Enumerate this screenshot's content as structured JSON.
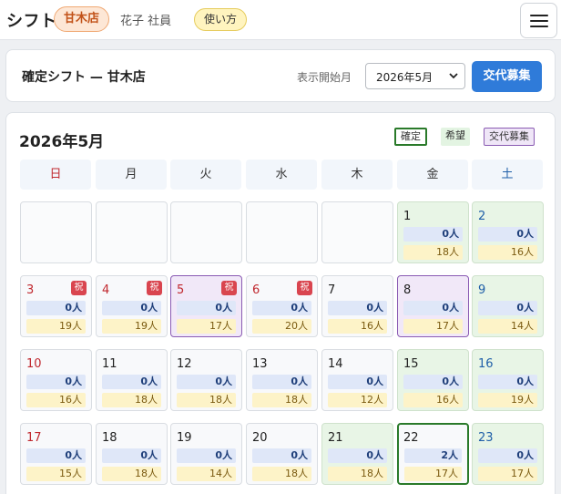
{
  "topbar": {
    "brand": "シフト",
    "store": "甘木店",
    "user": "花子 社員",
    "howto": "使い方"
  },
  "header": {
    "title": "確定シフト — 甘木店",
    "month_label": "表示開始月",
    "month_value": "2026年5月",
    "recruit_button": "交代募集"
  },
  "calendar": {
    "title": "2026年5月",
    "legend": {
      "confirmed": "確定",
      "wish": "希望",
      "swap": "交代募集"
    },
    "weekdays": [
      "日",
      "月",
      "火",
      "水",
      "木",
      "金",
      "土"
    ],
    "holiday_label": "祝",
    "days": [
      {
        "date": "1",
        "a": "0人",
        "b": "18人"
      },
      {
        "date": "2",
        "a": "0人",
        "b": "16人"
      },
      {
        "date": "3",
        "a": "0人",
        "b": "19人"
      },
      {
        "date": "4",
        "a": "0人",
        "b": "19人"
      },
      {
        "date": "5",
        "a": "0人",
        "b": "17人"
      },
      {
        "date": "6",
        "a": "0人",
        "b": "20人"
      },
      {
        "date": "7",
        "a": "0人",
        "b": "16人"
      },
      {
        "date": "8",
        "a": "0人",
        "b": "17人"
      },
      {
        "date": "9",
        "a": "0人",
        "b": "14人"
      },
      {
        "date": "10",
        "a": "0人",
        "b": "16人"
      },
      {
        "date": "11",
        "a": "0人",
        "b": "18人"
      },
      {
        "date": "12",
        "a": "0人",
        "b": "18人"
      },
      {
        "date": "13",
        "a": "0人",
        "b": "18人"
      },
      {
        "date": "14",
        "a": "0人",
        "b": "12人"
      },
      {
        "date": "15",
        "a": "0人",
        "b": "16人"
      },
      {
        "date": "16",
        "a": "0人",
        "b": "19人"
      },
      {
        "date": "17",
        "a": "0人",
        "b": "15人"
      },
      {
        "date": "18",
        "a": "0人",
        "b": "18人"
      },
      {
        "date": "19",
        "a": "0人",
        "b": "14人"
      },
      {
        "date": "20",
        "a": "0人",
        "b": "18人"
      },
      {
        "date": "21",
        "a": "0人",
        "b": "18人"
      },
      {
        "date": "22",
        "a": "2人",
        "b": "17人"
      },
      {
        "date": "23",
        "a": "0人",
        "b": "17人"
      }
    ]
  },
  "colors": {
    "accent": "#2f7bd9",
    "sunday": "#c0282e",
    "saturday": "#1f5fa8",
    "holiday": "#d9454f",
    "confirmed_border": "#2a7a2a",
    "wish_bg": "#e3f4e2",
    "swap_border": "#8a5bb3"
  }
}
